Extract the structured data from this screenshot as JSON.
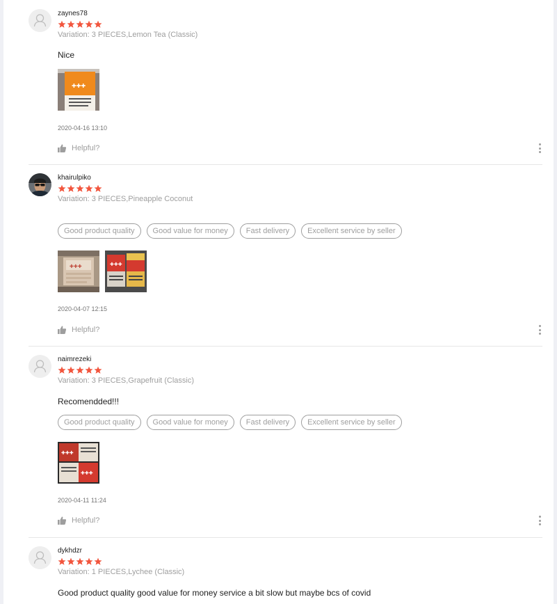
{
  "colors": {
    "star": "#f2553d",
    "muted": "#9e9e9e",
    "divider": "#e6e6e6"
  },
  "helpful_label": "Helpful?",
  "reviews": [
    {
      "username": "zaynes78",
      "rating": 5,
      "variation": "Variation: 3 PIECES,Lemon Tea (Classic)",
      "content": "Nice",
      "tags": [],
      "photo_count": 1,
      "date": "2020-04-16 13:10",
      "avatar": "default-avatar-icon"
    },
    {
      "username": "khairulpiko",
      "rating": 5,
      "variation": "Variation: 3 PIECES,Pineapple Coconut",
      "content": "",
      "tags": [
        "Good product quality",
        "Good value for money",
        "Fast delivery",
        "Excellent service by seller"
      ],
      "photo_count": 2,
      "date": "2020-04-07 12:15",
      "avatar": "user-photo-avatar"
    },
    {
      "username": "naimrezeki",
      "rating": 5,
      "variation": "Variation: 3 PIECES,Grapefruit (Classic)",
      "content": "Recomendded!!!",
      "tags": [
        "Good product quality",
        "Good value for money",
        "Fast delivery",
        "Excellent service by seller"
      ],
      "photo_count": 1,
      "date": "2020-04-11 11:24",
      "avatar": "default-avatar-icon"
    },
    {
      "username": "dykhdzr",
      "rating": 5,
      "variation": "Variation: 1 PIECES,Lychee (Classic)",
      "content": "Good product quality good value for money service a bit slow but maybe bcs of covid",
      "tags": [],
      "photo_count": 0,
      "date": "",
      "avatar": "default-avatar-icon"
    }
  ]
}
